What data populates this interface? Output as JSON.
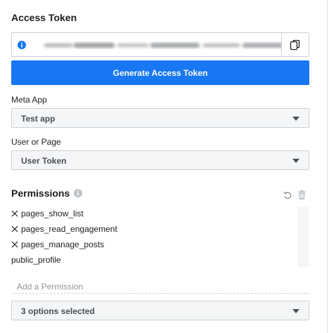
{
  "access_token": {
    "title": "Access Token",
    "token_value": "",
    "generate_label": "Generate Access Token"
  },
  "meta_app": {
    "label": "Meta App",
    "selected": "Test app"
  },
  "user_or_page": {
    "label": "User or Page",
    "selected": "User Token"
  },
  "permissions": {
    "title": "Permissions",
    "items": [
      {
        "label": "pages_show_list",
        "removable": true
      },
      {
        "label": "pages_read_engagement",
        "removable": true
      },
      {
        "label": "pages_manage_posts",
        "removable": true
      },
      {
        "label": "public_profile",
        "removable": false
      }
    ],
    "add_placeholder": "Add a Permission",
    "options_selected": "3 options selected"
  },
  "colors": {
    "primary": "#1877f2",
    "info": "#1877f2",
    "text": "#1c1e21"
  },
  "icons": [
    "info-icon",
    "copy-icon",
    "help-icon",
    "undo-icon",
    "trash-icon",
    "remove-icon",
    "caret-down-icon"
  ]
}
